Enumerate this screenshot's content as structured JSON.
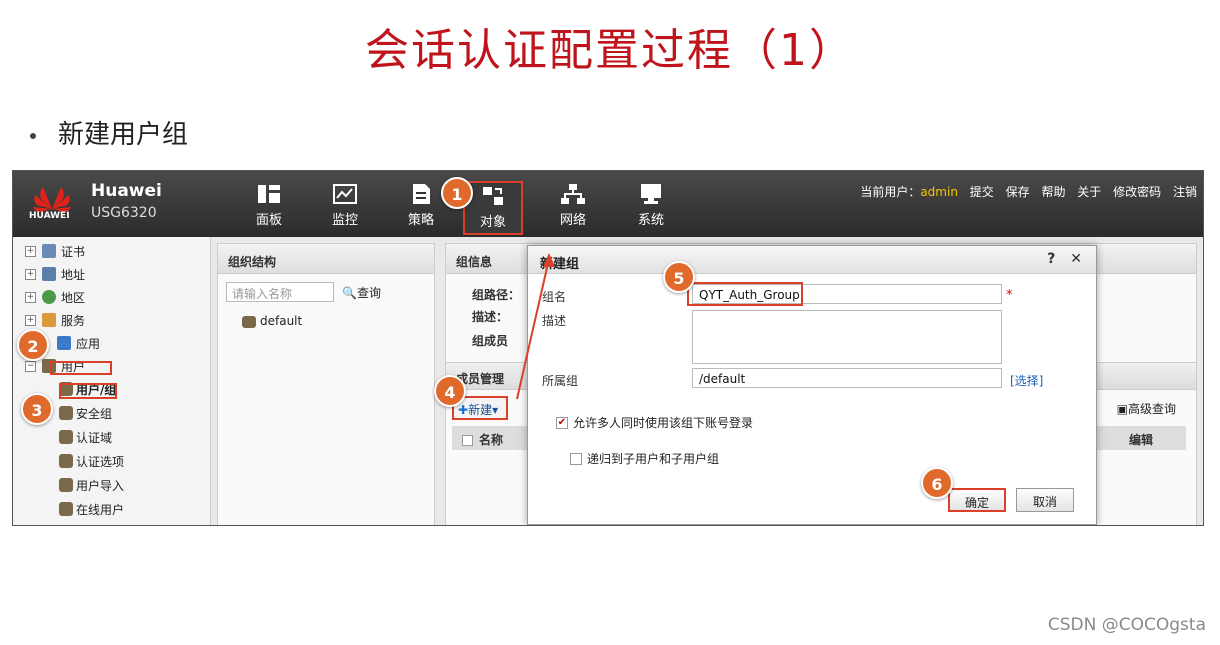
{
  "slide": {
    "title": "会话认证配置过程（1）",
    "bullet": "新建用户组",
    "watermark": "CSDN @COCOgsta"
  },
  "app": {
    "logo_word": "HUAWEI",
    "brand": "Huawei",
    "model": "USG6320",
    "nav": [
      "面板",
      "监控",
      "策略",
      "对象",
      "网络",
      "系统"
    ],
    "active_nav": "对象",
    "user_label": "当前用户：",
    "user_name": "admin",
    "user_links": [
      "提交",
      "保存",
      "帮助",
      "关于",
      "修改密码",
      "注销"
    ]
  },
  "sidebar": {
    "items": [
      "证书",
      "地址",
      "地区",
      "服务",
      "应用",
      "用户"
    ],
    "user_sub": [
      "用户/组",
      "安全组",
      "认证域",
      "认证选项",
      "用户导入",
      "在线用户"
    ]
  },
  "org_panel": {
    "title": "组织结构",
    "search_placeholder": "请输入名称",
    "query": "查询",
    "root": "default"
  },
  "info_panel": {
    "title": "组信息",
    "path_label": "组路径：",
    "desc_label": "描述：",
    "members_label": "组成员",
    "member_mgmt": "成员管理",
    "new_btn": "新建▾",
    "col_name": "名称",
    "adv_query": "高级查询",
    "col_edit": "编辑"
  },
  "dialog": {
    "title": "新建组",
    "help": "?",
    "close": "✕",
    "name_label": "组名",
    "name_value": "QYT_Auth_Group",
    "desc_label": "描述",
    "parent_label": "所属组",
    "parent_value": "/default",
    "select_link": "[选择]",
    "chk_multi": "允许多人同时使用该组下账号登录",
    "chk_multi_checked": true,
    "chk_recursive": "递归到子用户和子用户组",
    "chk_recursive_checked": false,
    "ok": "确定",
    "cancel": "取消"
  },
  "steps": [
    "1",
    "2",
    "3",
    "4",
    "5",
    "6"
  ],
  "colors": {
    "accent": "#c0141d",
    "badge": "#e06a2c",
    "highlight": "#d9402a"
  }
}
